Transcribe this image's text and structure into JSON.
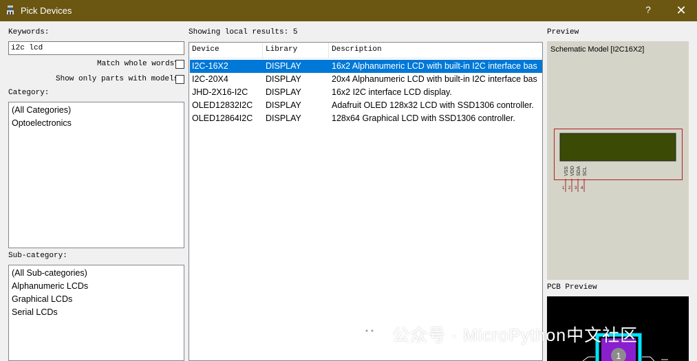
{
  "window": {
    "title": "Pick Devices",
    "help_label": "?",
    "close_label": "✕"
  },
  "keywords": {
    "label": "Keywords:",
    "value": "i2c lcd"
  },
  "options": {
    "match_whole_words": "Match whole words?",
    "show_only_models": "Show only parts with models?"
  },
  "category": {
    "label": "Category:",
    "items": [
      "(All Categories)",
      "Optoelectronics"
    ]
  },
  "subcategory": {
    "label": "Sub-category:",
    "items": [
      "(All Sub-categories)",
      "Alphanumeric LCDs",
      "Graphical LCDs",
      "Serial LCDs"
    ]
  },
  "results": {
    "summary": "Showing local results: 5",
    "columns": [
      "Device",
      "Library",
      "Description"
    ],
    "rows": [
      {
        "device": "I2C-16X2",
        "library": "DISPLAY",
        "description": "16x2 Alphanumeric LCD with built-in I2C interface bas",
        "selected": true
      },
      {
        "device": "I2C-20X4",
        "library": "DISPLAY",
        "description": "20x4 Alphanumeric LCD with built-in I2C interface bas",
        "selected": false
      },
      {
        "device": "JHD-2X16-I2C",
        "library": "DISPLAY",
        "description": "16x2 I2C interface LCD display.",
        "selected": false
      },
      {
        "device": "OLED12832I2C",
        "library": "DISPLAY",
        "description": "Adafruit OLED 128x32 LCD with SSD1306 controller.",
        "selected": false
      },
      {
        "device": "OLED12864I2C",
        "library": "DISPLAY",
        "description": "128x64 Graphical LCD with SSD1306 controller.",
        "selected": false
      }
    ]
  },
  "preview": {
    "label": "Preview",
    "model_text": "Schematic Model [I2C16X2]",
    "pins": [
      "VSS",
      "VDD",
      "SDA",
      "SCL"
    ],
    "pin_numbers": [
      "1",
      "2",
      "3",
      "4"
    ]
  },
  "pcb_preview": {
    "label": "PCB Preview",
    "pad_number": "1"
  },
  "watermark": {
    "text": "公众号 · MicroPython中文社区"
  },
  "colors": {
    "titlebar": "#6b5612",
    "selection": "#0078d7",
    "lcd_screen": "#3b4a05",
    "outline_red": "#b02020",
    "pcb_cyan": "#00e5ff",
    "pcb_purple": "#8a1fd0"
  }
}
